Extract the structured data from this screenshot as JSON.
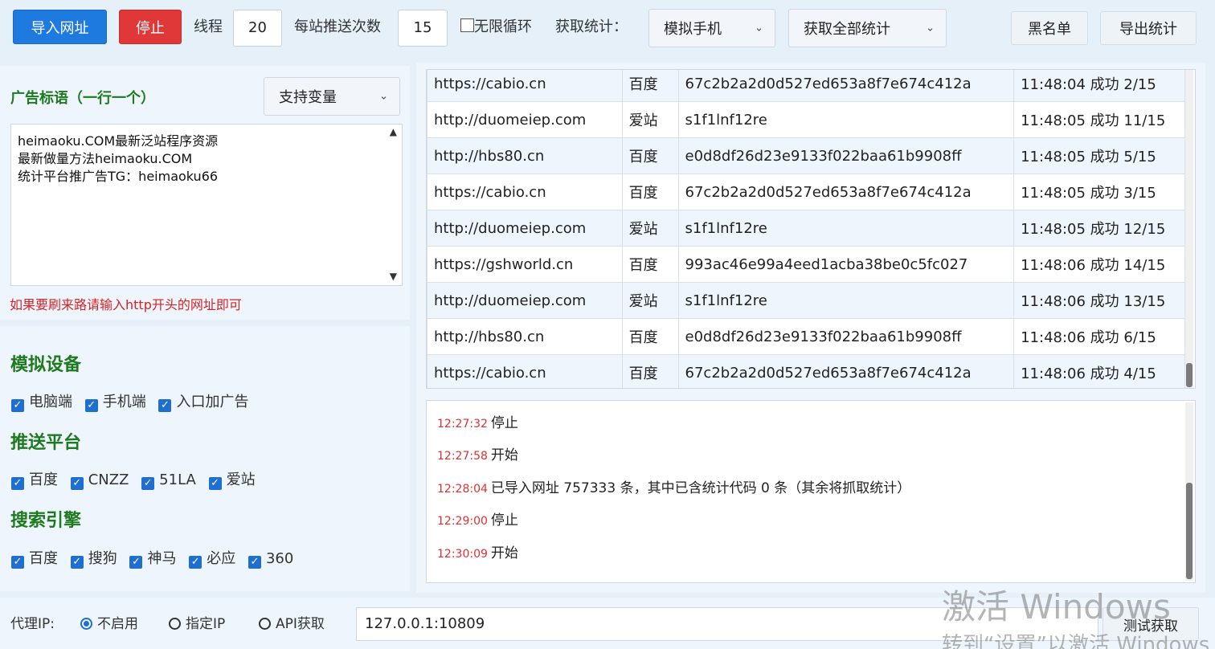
{
  "toolbar": {
    "import_label": "导入网址",
    "stop_label": "停止",
    "threads_label": "线程",
    "threads_value": "20",
    "push_count_label": "每站推送次数",
    "push_count_value": "15",
    "infinite_loop_label": "无限循环",
    "stats_label": "获取统计：",
    "device_select": "模拟手机",
    "stats_select": "获取全部统计",
    "blacklist_label": "黑名单",
    "export_label": "导出统计"
  },
  "ad": {
    "title": "广告标语（一行一个）",
    "variable_select": "支持变量",
    "lines": [
      "heimaoku.COM最新泛站程序资源",
      "最新做量方法heimaoku.COM",
      "统计平台推广告TG：heimaoku66"
    ],
    "hint": "如果要刷来路请输入http开头的网址即可"
  },
  "device": {
    "title": "模拟设备",
    "options": [
      "电脑端",
      "手机端",
      "入口加广告"
    ]
  },
  "platform": {
    "title": "推送平台",
    "options": [
      "百度",
      "CNZZ",
      "51LA",
      "爱站"
    ]
  },
  "engine": {
    "title": "搜索引擎",
    "options": [
      "百度",
      "搜狗",
      "神马",
      "必应",
      "360"
    ]
  },
  "table": {
    "rows": [
      {
        "url": "https://cabio.cn",
        "platform": "百度",
        "code": "67c2b2a2d0d527ed653a8f7e674c412a",
        "status": "11:48:04 成功 2/15"
      },
      {
        "url": "http://duomeiep.com",
        "platform": "爱站",
        "code": "s1f1lnf12re",
        "status": "11:48:05 成功 11/15"
      },
      {
        "url": "http://hbs80.cn",
        "platform": "百度",
        "code": "e0d8df26d23e9133f022baa61b9908ff",
        "status": "11:48:05 成功 5/15"
      },
      {
        "url": "https://cabio.cn",
        "platform": "百度",
        "code": "67c2b2a2d0d527ed653a8f7e674c412a",
        "status": "11:48:05 成功 3/15"
      },
      {
        "url": "http://duomeiep.com",
        "platform": "爱站",
        "code": "s1f1lnf12re",
        "status": "11:48:05 成功 12/15"
      },
      {
        "url": "https://gshworld.cn",
        "platform": "百度",
        "code": "993ac46e99a4eed1acba38be0c5fc027",
        "status": "11:48:06 成功 14/15"
      },
      {
        "url": "http://duomeiep.com",
        "platform": "爱站",
        "code": "s1f1lnf12re",
        "status": "11:48:06 成功 13/15"
      },
      {
        "url": "http://hbs80.cn",
        "platform": "百度",
        "code": "e0d8df26d23e9133f022baa61b9908ff",
        "status": "11:48:06 成功 6/15"
      },
      {
        "url": "https://cabio.cn",
        "platform": "百度",
        "code": "67c2b2a2d0d527ed653a8f7e674c412a",
        "status": "11:48:06 成功 4/15"
      }
    ]
  },
  "log": [
    {
      "time": "12:27:32",
      "text": "停止"
    },
    {
      "time": "12:27:58",
      "text": "开始"
    },
    {
      "time": "12:28:04",
      "text": "已导入网址 757333 条，其中已含统计代码 0 条（其余将抓取统计）"
    },
    {
      "time": "12:29:00",
      "text": "停止"
    },
    {
      "time": "12:30:09",
      "text": "开始"
    }
  ],
  "proxy": {
    "label": "代理IP:",
    "opt_off": "不启用",
    "opt_ip": "指定IP",
    "opt_api": "API获取",
    "value": "127.0.0.1:10809",
    "test_label": "测试获取"
  },
  "watermark": {
    "line1": "激活 Windows",
    "line2": "转到“设置”以激活 Windows"
  },
  "colors": {
    "primary": "#1f7ae0",
    "danger": "#e03838",
    "heading": "#1e7a1e",
    "log_time": "#e03030"
  }
}
